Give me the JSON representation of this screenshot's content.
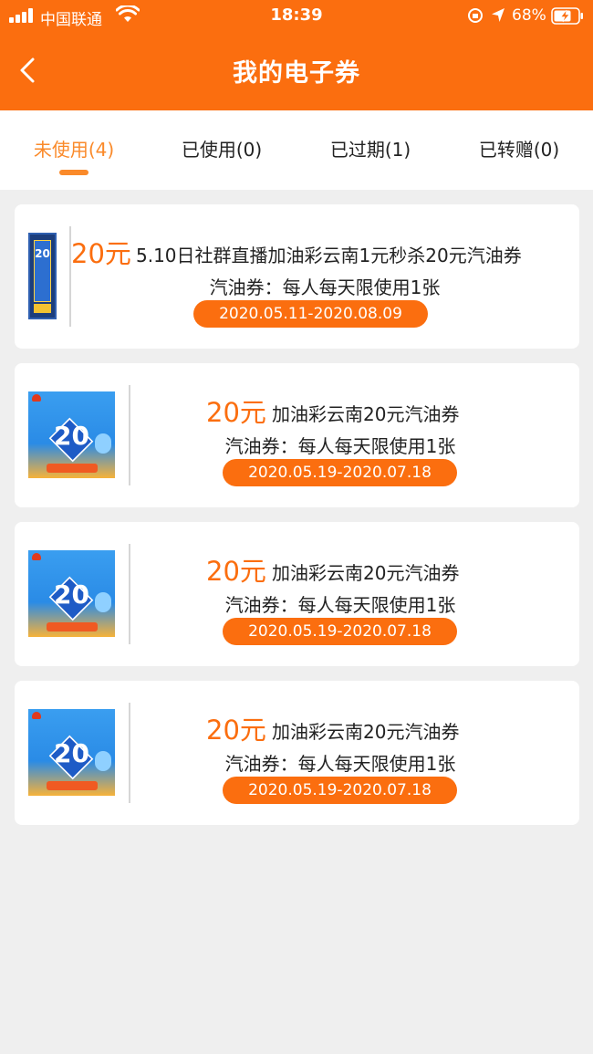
{
  "status_bar": {
    "carrier": "中国联通",
    "time": "18:39",
    "battery_percent": "68%"
  },
  "nav": {
    "title": "我的电子券",
    "back_icon": "chevron-left-icon"
  },
  "tabs": [
    {
      "label": "未使用(4)",
      "active": true
    },
    {
      "label": "已使用(0)",
      "active": false
    },
    {
      "label": "已过期(1)",
      "active": false
    },
    {
      "label": "已转赠(0)",
      "active": false
    }
  ],
  "coupons": [
    {
      "amount": "20元",
      "title": "5.10日社群直播加油彩云南1元秒杀20元汽油券",
      "description": "汽油券：每人每天限使用1张",
      "validity": "2020.05.11-2020.08.09",
      "thumb_number": "20"
    },
    {
      "amount": "20元",
      "title": "加油彩云南20元汽油券",
      "description": "汽油券：每人每天限使用1张",
      "validity": "2020.05.19-2020.07.18",
      "thumb_number": "20"
    },
    {
      "amount": "20元",
      "title": "加油彩云南20元汽油券",
      "description": "汽油券：每人每天限使用1张",
      "validity": "2020.05.19-2020.07.18",
      "thumb_number": "20"
    },
    {
      "amount": "20元",
      "title": "加油彩云南20元汽油券",
      "description": "汽油券：每人每天限使用1张",
      "validity": "2020.05.19-2020.07.18",
      "thumb_number": "20"
    }
  ],
  "colors": {
    "brand": "#fb6e0f",
    "tab_active": "#fa8a2a",
    "background": "#efefef"
  }
}
